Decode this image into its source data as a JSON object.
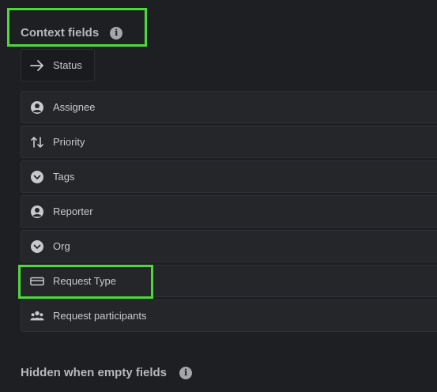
{
  "context_section": {
    "title": "Context fields",
    "info_icon": "i"
  },
  "status_field": {
    "label": "Status",
    "icon": "arrow-right-icon"
  },
  "fields": [
    {
      "label": "Assignee",
      "icon": "user-circle-icon"
    },
    {
      "label": "Priority",
      "icon": "sort-arrows-icon"
    },
    {
      "label": "Tags",
      "icon": "chevron-circle-icon"
    },
    {
      "label": "Reporter",
      "icon": "user-circle-icon"
    },
    {
      "label": "Org",
      "icon": "chevron-circle-icon"
    },
    {
      "label": "Request Type",
      "icon": "card-icon"
    },
    {
      "label": "Request participants",
      "icon": "people-icon"
    }
  ],
  "hidden_section": {
    "title": "Hidden when empty fields",
    "info_icon": "i"
  },
  "colors": {
    "background": "#1e1f22",
    "row_background": "#25262a",
    "highlight": "#4ed93a",
    "text": "#c7c9cc"
  }
}
